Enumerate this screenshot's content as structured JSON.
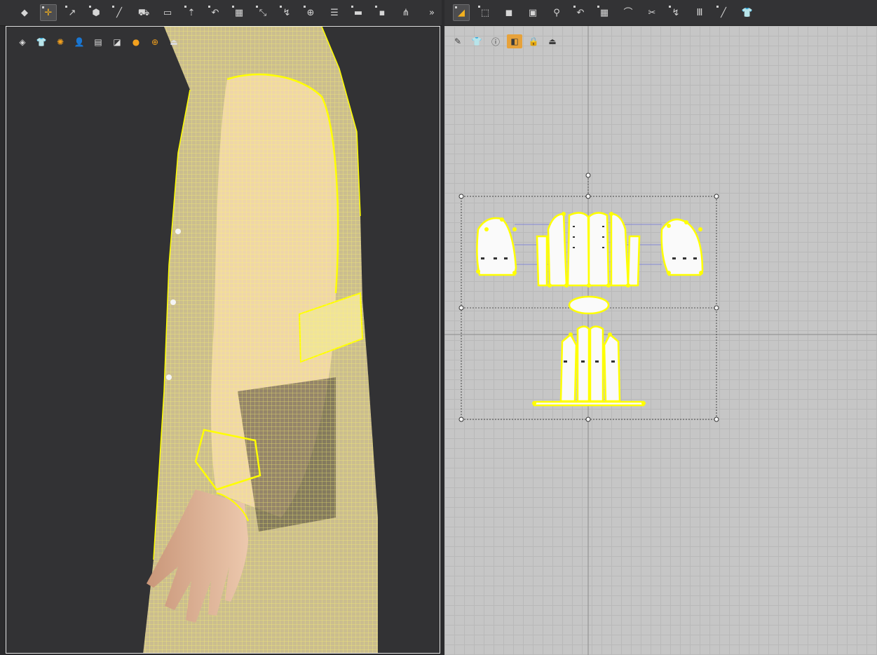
{
  "toolbar_left": {
    "icons": [
      "object-select-icon",
      "transform-pattern-icon",
      "edit-pattern-icon",
      "polygon-pattern-icon",
      "segment-pattern-icon",
      "trace-pattern-icon",
      "internal-line-icon",
      "add-pin-icon",
      "fold-arrangement-icon",
      "mesh-icon",
      "sew-segment-icon",
      "free-sew-icon",
      "tack-icon",
      "button-icon",
      "puckering-icon",
      "elastic-icon",
      "zipper-icon",
      "expand-more-icon"
    ]
  },
  "toolbar_right": {
    "icons": [
      "edit-pattern-2d-icon",
      "transform-pattern-2d-icon",
      "rectangle-icon",
      "internal-rectangle-icon",
      "add-pin-2d-icon",
      "fold-2d-icon",
      "mesh-2d-icon",
      "ironing-icon",
      "seam-2d-icon",
      "free-seam-2d-icon",
      "columns-icon",
      "line-2d-icon",
      "garment-icon"
    ]
  },
  "viewport_3d": {
    "tools": [
      "texture-view-icon",
      "garment-view-icon",
      "sun-icon",
      "avatar-icon",
      "pattern-view-icon",
      "shading-icon",
      "avatar-skin-icon",
      "globe-icon",
      "export-icon"
    ]
  },
  "viewport_2d": {
    "tools": [
      "brush-view-icon",
      "garment-eye-icon",
      "info-icon",
      "fabric-color-icon",
      "lock-icon",
      "export-2d-icon"
    ]
  },
  "colors": {
    "toolbar_bg": "#333335",
    "viewport_3d_bg": "#323234",
    "viewport_2d_bg": "#c6c6c6",
    "pattern_outline": "#ffff00",
    "accent": "#f3b01e"
  }
}
